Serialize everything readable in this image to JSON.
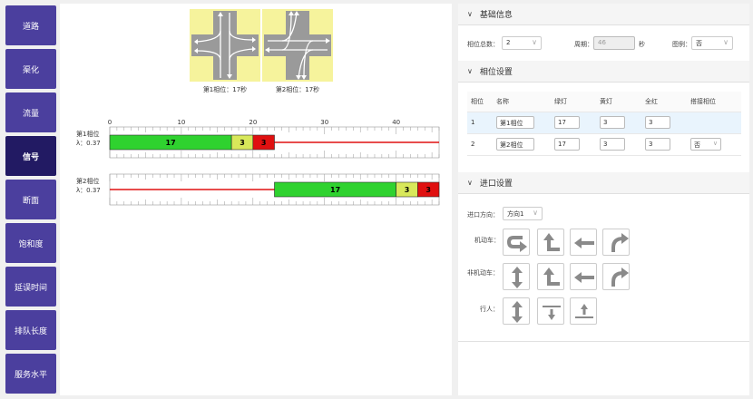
{
  "sidebar": {
    "items": [
      {
        "label": "道路",
        "active": false
      },
      {
        "label": "渠化",
        "active": false
      },
      {
        "label": "流量",
        "active": false
      },
      {
        "label": "信号",
        "active": true
      },
      {
        "label": "断面",
        "active": false
      },
      {
        "label": "饱和度",
        "active": false
      },
      {
        "label": "延误时间",
        "active": false
      },
      {
        "label": "排队长度",
        "active": false
      },
      {
        "label": "服务水平",
        "active": false
      }
    ]
  },
  "phase_diagrams": [
    {
      "caption": "第1相位：17秒"
    },
    {
      "caption": "第2相位：17秒"
    }
  ],
  "timing": {
    "scale_ticks": [
      "0",
      "10",
      "20",
      "30",
      "40"
    ],
    "scale_max": 46,
    "phases": [
      {
        "name": "第1相位",
        "lambda": "λ：0.37",
        "green_start": 0,
        "green": 17,
        "yellow": 3,
        "red": 3,
        "green_label": "17",
        "yellow_label": "3",
        "red_label": "3"
      },
      {
        "name": "第2相位",
        "lambda": "λ：0.37",
        "green_start": 23,
        "green": 17,
        "yellow": 3,
        "red": 3,
        "green_label": "17",
        "yellow_label": "3",
        "red_label": "3"
      }
    ]
  },
  "basic_info": {
    "title": "基础信息",
    "phase_count_label": "相位总数：",
    "phase_count_value": "2",
    "cycle_label": "周期：",
    "cycle_value": "46",
    "cycle_unit": "秒",
    "legend_label": "图例：",
    "legend_value": "否"
  },
  "phase_settings": {
    "title": "相位设置",
    "headers": [
      "相位",
      "名称",
      "绿灯",
      "黄灯",
      "全红",
      "搭接相位"
    ],
    "rows": [
      {
        "index": "1",
        "name": "第1相位",
        "green": "17",
        "yellow": "3",
        "red": "3",
        "overlap": ""
      },
      {
        "index": "2",
        "name": "第2相位",
        "green": "17",
        "yellow": "3",
        "red": "3",
        "overlap": "否"
      }
    ]
  },
  "approach_settings": {
    "title": "进口设置",
    "direction_label": "进口方向：",
    "direction_value": "方向1",
    "motor_label": "机动车：",
    "nonmotor_label": "非机动车：",
    "ped_label": "行人："
  },
  "colors": {
    "nav_bg": "#4b3f9e",
    "nav_active": "#221a63",
    "green": "#2fd22f",
    "yellow": "#d8e85a",
    "red": "#e01010"
  }
}
